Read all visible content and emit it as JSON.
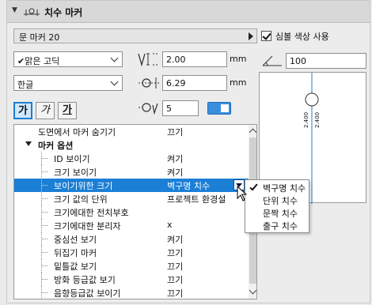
{
  "panel": {
    "title": "치수 마커",
    "marker_type": "문 마커 20",
    "use_symbol_color_label": "심볼 색상 사용",
    "use_symbol_color_checked": true,
    "font": {
      "checked": true,
      "name": "맑은 고딕"
    },
    "script": "한글",
    "style_buttons": [
      "가",
      "가",
      "가"
    ],
    "size_value": "2.00",
    "size_unit": "mm",
    "offset_value": "6.29",
    "offset_unit": "mm",
    "pen_value": "5",
    "angle_value": "100",
    "preview_texts": [
      "2.400",
      "2.400"
    ]
  },
  "settings_list": [
    {
      "name": "도면에서 마커 숨기기",
      "value": "끄기"
    },
    {
      "name": "마커 옵션",
      "value": ""
    },
    {
      "name": "ID 보이기",
      "value": "켜기"
    },
    {
      "name": "크기 보이기",
      "value": "켜기"
    },
    {
      "name": "보이기위한 크기",
      "value": "벽구명 치수"
    },
    {
      "name": "크기 값의 단위",
      "value": "프로젝트 환경설"
    },
    {
      "name": "크기에대한 전치부호",
      "value": ""
    },
    {
      "name": "크기에대한 분리자",
      "value": "x"
    },
    {
      "name": "중심선 보기",
      "value": "켜기"
    },
    {
      "name": "뒤집기 마커",
      "value": "끄기"
    },
    {
      "name": "밑틀값 보기",
      "value": "끄기"
    },
    {
      "name": "방화 등급값 보기",
      "value": "끄기"
    },
    {
      "name": "음향등급값 보이기",
      "value": "끄기"
    }
  ],
  "dropdown_options": [
    "벽구명 치수",
    "단위 치수",
    "문짝 치수",
    "출구 치수"
  ],
  "colors": {
    "selection": "#1b7fd6",
    "accent": "#1d7fd0"
  }
}
